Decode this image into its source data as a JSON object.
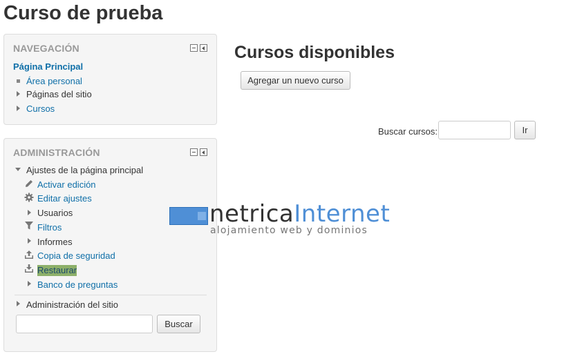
{
  "page": {
    "title": "Curso de prueba"
  },
  "navigation": {
    "title": "NAVEGACIÓN",
    "home": "Página Principal",
    "items": [
      {
        "label": "Área personal",
        "icon": "bullet-icon"
      },
      {
        "label": "Páginas del sitio",
        "icon": "expand-icon"
      },
      {
        "label": "Cursos",
        "icon": "expand-icon"
      }
    ]
  },
  "administration": {
    "title": "ADMINISTRACIÓN",
    "section_label": "Ajustes de la página principal",
    "items": [
      {
        "label": "Activar edición",
        "icon": "pencil-icon"
      },
      {
        "label": "Editar ajustes",
        "icon": "gear-icon"
      },
      {
        "label": "Usuarios",
        "icon": "expand-icon"
      },
      {
        "label": "Filtros",
        "icon": "filter-icon"
      },
      {
        "label": "Informes",
        "icon": "expand-icon"
      },
      {
        "label": "Copia de seguridad",
        "icon": "upload-icon"
      },
      {
        "label": "Restaurar",
        "icon": "download-icon"
      },
      {
        "label": "Banco de preguntas",
        "icon": "expand-icon"
      }
    ],
    "site_admin": "Administración del sitio",
    "search_button": "Buscar",
    "search_value": ""
  },
  "main": {
    "heading": "Cursos disponibles",
    "add_course_button": "Agregar un nuevo curso",
    "search_label": "Buscar cursos:",
    "search_value": "",
    "go_button": "Ir"
  },
  "watermark": {
    "text_dark": "netrica",
    "text_blue": "Internet",
    "subtitle": "alojamiento web y dominios"
  },
  "colors": {
    "link": "#0f6fa8",
    "highlight": "#8db06a",
    "heading": "#333333",
    "block_title": "#999999"
  }
}
